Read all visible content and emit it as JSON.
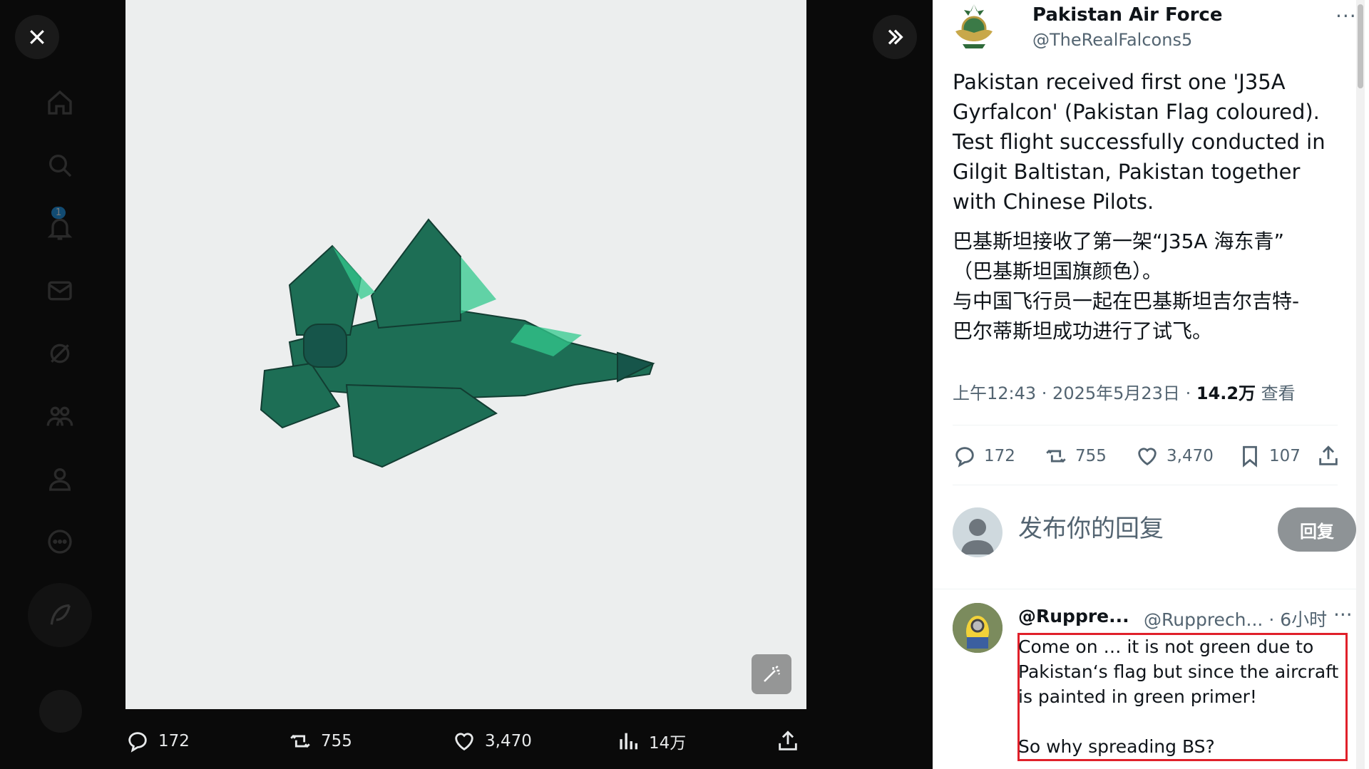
{
  "nav": {
    "items": [
      "home-icon",
      "search-icon",
      "bell-icon",
      "mail-icon",
      "grok-icon",
      "communities-icon",
      "profile-icon",
      "more-icon"
    ],
    "notif_count": "1"
  },
  "media_actions": {
    "reply": "172",
    "retweet": "755",
    "like": "3,470",
    "views": "14万"
  },
  "author": {
    "name": "Pakistan Air Force",
    "handle": "@TheRealFalcons5",
    "more": "···"
  },
  "tweet": {
    "text_en": "Pakistan received first one 'J35A Gyrfalcon' (Pakistan Flag coloured). Test flight successfully conducted in Gilgit Baltistan, Pakistan together with Chinese Pilots.",
    "text_zh": "巴基斯坦接收了第一架“J35A 海东青”\n（巴基斯坦国旗颜色）。\n与中国飞行员一起在巴基斯坦吉尔吉特-\n巴尔蒂斯坦成功进行了试飞。",
    "time": "上午12:43 · 2025年5月23日 · ",
    "views_count": "14.2万",
    "views_label": " 查看"
  },
  "stats": {
    "reply": "172",
    "retweet": "755",
    "like": "3,470",
    "bookmark": "107"
  },
  "reply_box": {
    "placeholder": "发布你的回复",
    "button": "回复"
  },
  "reply_tweet": {
    "name": "@Ruppre...",
    "handle": "@Rupprech... · 6小时",
    "more": "···",
    "text": "Come on … it is not green due to Pakistan‘s flag but since the aircraft is painted in green primer!\n\nSo why spreading BS?"
  },
  "colors": {
    "accent": "#1d9bf0",
    "highlight_box": "#e0202a",
    "jet_green": "#1f7a5a"
  }
}
